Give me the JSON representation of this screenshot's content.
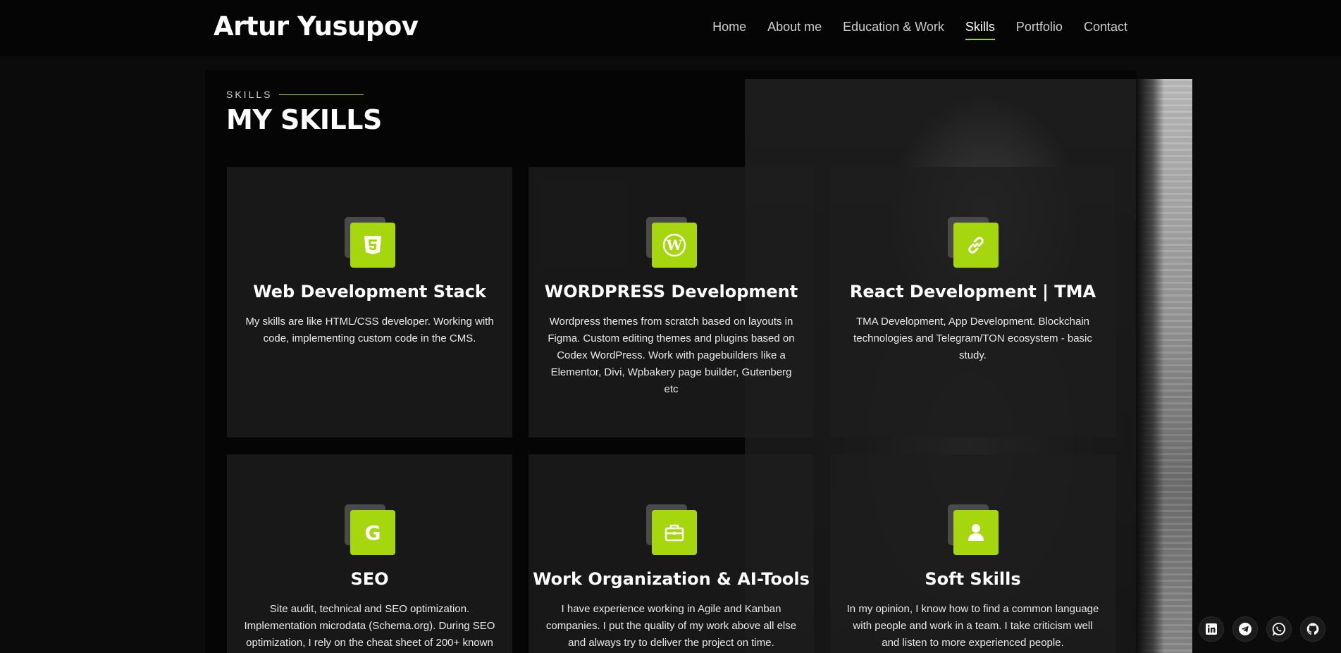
{
  "header": {
    "brand": "Artur Yusupov",
    "nav": [
      {
        "label": "Home",
        "active": false
      },
      {
        "label": "About me",
        "active": false
      },
      {
        "label": "Education & Work",
        "active": false
      },
      {
        "label": "Skills",
        "active": true
      },
      {
        "label": "Portfolio",
        "active": false
      },
      {
        "label": "Contact",
        "active": false
      }
    ]
  },
  "section": {
    "kicker": "SKILLS",
    "title": "MY SKILLS"
  },
  "cards": [
    {
      "icon": "html5-icon",
      "title": "Web Development Stack",
      "text": "My skills are like HTML/CSS developer. Working with code, implementing custom code in the CMS."
    },
    {
      "icon": "wordpress-icon",
      "title": "WORDPRESS Development",
      "text": "Wordpress themes from scratch based on layouts in Figma. Custom editing themes and plugins based on Codex WordPress. Work with pagebuilders like a Elementor, Divi, Wpbakery page builder, Gutenberg etc"
    },
    {
      "icon": "link-icon",
      "title": "React Development | TMA",
      "text": "TMA Development, App Development. Blockchain technologies and Telegram/TON ecosystem - basic study."
    },
    {
      "icon": "google-icon",
      "title": "SEO",
      "text": "Site audit, technical and SEO optimization. Implementation microdata (Schema.org). During SEO optimization, I rely on the cheat sheet of 200+ known"
    },
    {
      "icon": "briefcase-icon",
      "title": "Work Organization & AI-Tools",
      "text": "I have experience working in Agile and Kanban companies. I put the quality of my work above all else and always try to deliver the project on time."
    },
    {
      "icon": "user-icon",
      "title": "Soft Skills",
      "text": "In my opinion, I know how to find a common language with people and work in a team. I take criticism well and listen to more experienced people."
    }
  ],
  "social": [
    "linkedin-icon",
    "telegram-icon",
    "whatsapp-icon",
    "github-icon"
  ],
  "colors": {
    "accent": "#a6d60e",
    "background": "#0b0b0b",
    "card": "#1e1e1e"
  }
}
